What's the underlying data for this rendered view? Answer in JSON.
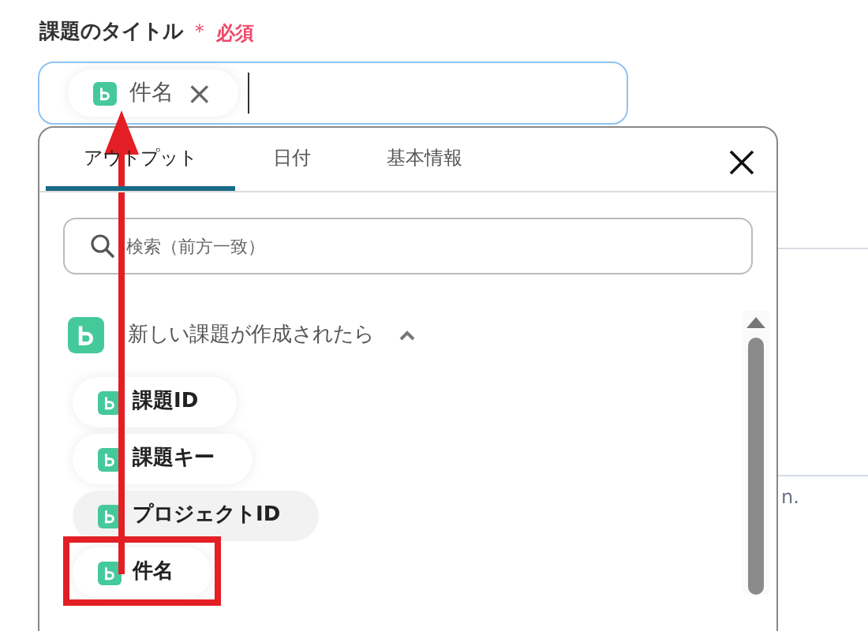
{
  "field": {
    "label": "課題のタイトル",
    "required_mark": "＊",
    "required_text": "必須",
    "focused": true,
    "chips": [
      {
        "label": "件名",
        "remove": "×"
      }
    ]
  },
  "background_text": "n.",
  "popup": {
    "tabs": [
      {
        "label": "アウトプット",
        "selected": true
      },
      {
        "label": "日付",
        "selected": false
      },
      {
        "label": "基本情報",
        "selected": false
      }
    ],
    "search": {
      "placeholder": "検索（前方一致）"
    },
    "group": {
      "title": "新しい課題が作成されたら",
      "expanded": true,
      "items": [
        {
          "label": "課題ID",
          "hovered": false,
          "highlighted": false
        },
        {
          "label": "課題キー",
          "hovered": false,
          "highlighted": false
        },
        {
          "label": "プロジェクトID",
          "hovered": true,
          "highlighted": false
        },
        {
          "label": "件名",
          "hovered": false,
          "highlighted": true
        }
      ]
    }
  }
}
